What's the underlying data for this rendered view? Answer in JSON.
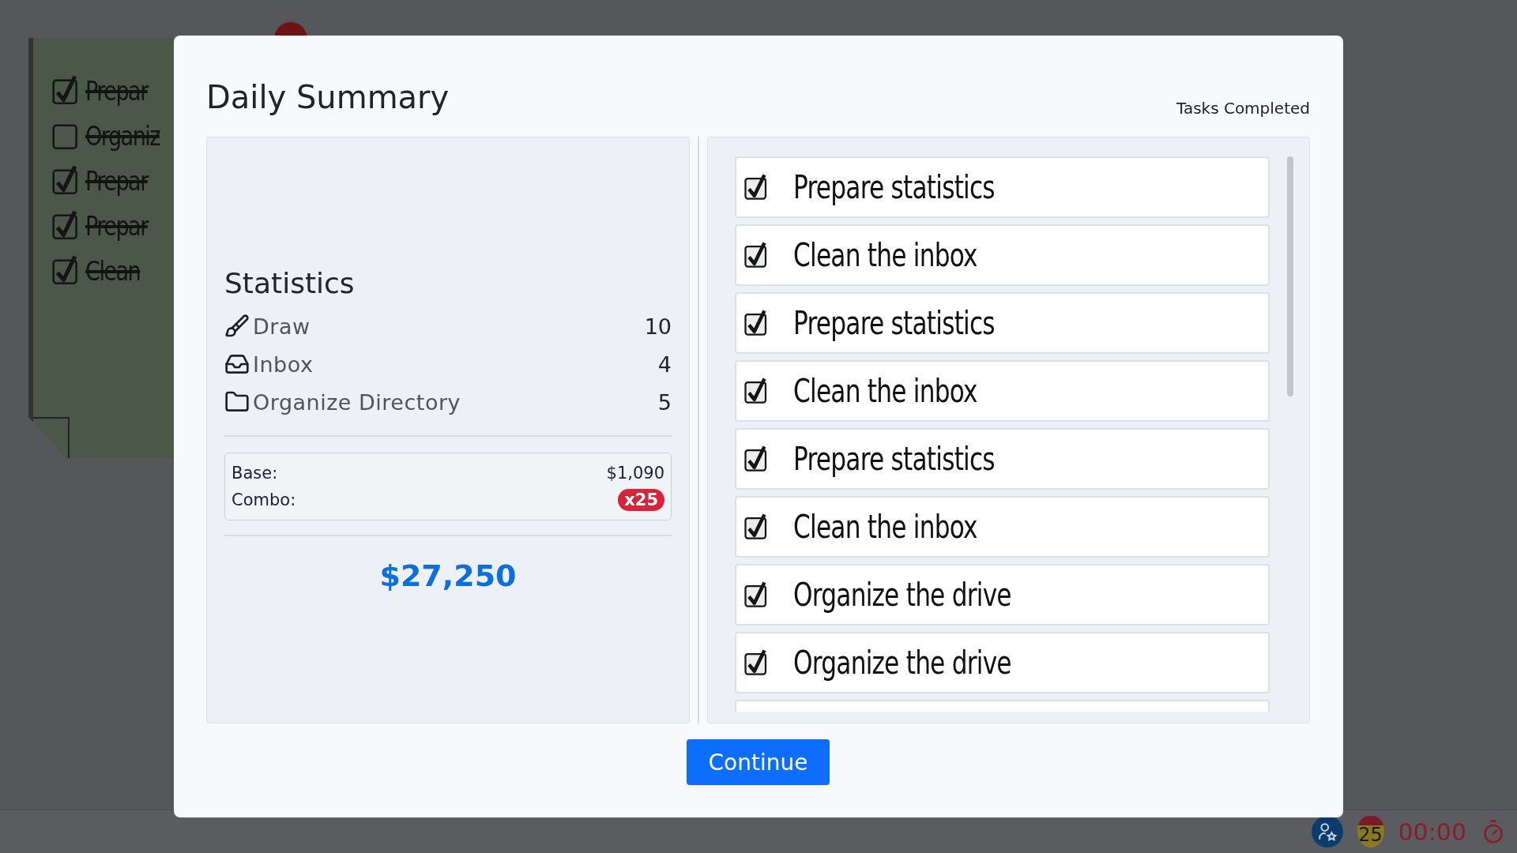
{
  "background_note": {
    "items": [
      {
        "text": "Prepar",
        "checked": true,
        "struck": true
      },
      {
        "text": "Organiz",
        "checked": false,
        "struck": true
      },
      {
        "text": "Prepar",
        "checked": true,
        "struck": true
      },
      {
        "text": "Prepar",
        "checked": true,
        "struck": true
      },
      {
        "text": "Clean",
        "checked": true,
        "struck": true
      }
    ]
  },
  "modal": {
    "title": "Daily Summary",
    "tasks_heading": "Tasks Completed",
    "statistics": {
      "title": "Statistics",
      "rows": [
        {
          "kind": "draw",
          "label": "Draw",
          "value": "10"
        },
        {
          "kind": "inbox",
          "label": "Inbox",
          "value": "4"
        },
        {
          "kind": "folder",
          "label": "Organize Directory",
          "value": "5"
        }
      ],
      "base_label": "Base:",
      "base_value": "$1,090",
      "combo_label": "Combo:",
      "combo_value": "x25",
      "total": "$27,250"
    },
    "tasks": [
      {
        "text": "Prepare statistics",
        "checked": true
      },
      {
        "text": "Clean the inbox",
        "checked": true
      },
      {
        "text": "Prepare statistics",
        "checked": true
      },
      {
        "text": "Clean the inbox",
        "checked": true
      },
      {
        "text": "Prepare statistics",
        "checked": true
      },
      {
        "text": "Clean the inbox",
        "checked": true
      },
      {
        "text": "Organize the drive",
        "checked": true
      },
      {
        "text": "Organize the drive",
        "checked": true
      }
    ],
    "continue_button": "Continue"
  },
  "status_bar": {
    "combo_badge": "25",
    "timer": "00:00"
  }
}
